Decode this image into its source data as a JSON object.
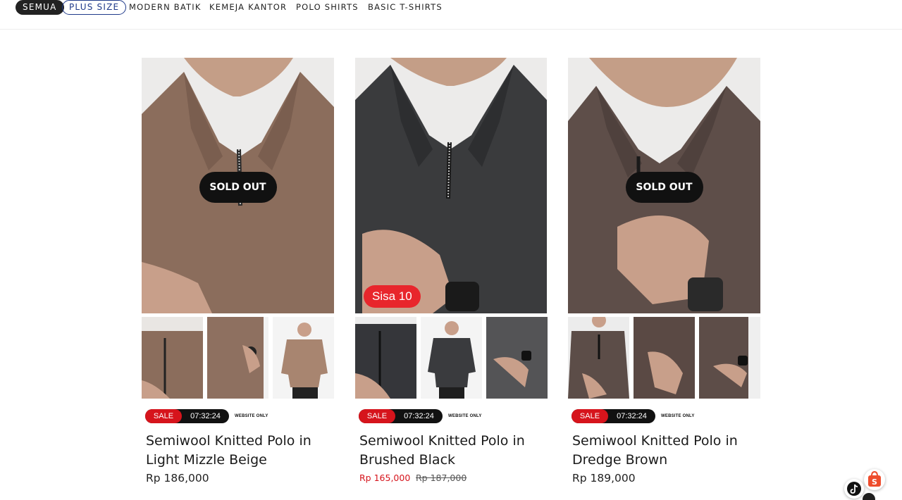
{
  "filters": {
    "items": [
      {
        "label": "SEMUA",
        "state": "active"
      },
      {
        "label": "PLUS SIZE",
        "state": "outline"
      },
      {
        "label": "MODERN BATIK",
        "state": "plain"
      },
      {
        "label": "KEMEJA KANTOR",
        "state": "plain"
      },
      {
        "label": "POLO SHIRTS",
        "state": "plain"
      },
      {
        "label": "BASIC T-SHIRTS",
        "state": "plain"
      }
    ]
  },
  "products": [
    {
      "name": "Semiwool Knitted Polo in Light Mizzle Beige",
      "badge": "SOLD OUT",
      "sale_label": "SALE",
      "timer": "07:32:24",
      "website_only": "WEBSITE ONLY",
      "price": "Rp 186,000",
      "shirt_color": "#8b6d5c"
    },
    {
      "name": "Semiwool Knitted Polo in Brushed Black",
      "stock_badge": "Sisa 10",
      "sale_label": "SALE",
      "timer": "07:32:24",
      "website_only": "WEBSITE ONLY",
      "sale_price": "Rp 165,000",
      "original_price": "Rp 187,000",
      "shirt_color": "#3a3b3d"
    },
    {
      "name": "Semiwool Knitted Polo in Dredge Brown",
      "badge": "SOLD OUT",
      "sale_label": "SALE",
      "timer": "07:32:24",
      "website_only": "WEBSITE ONLY",
      "price": "Rp 189,000",
      "shirt_color": "#5e4e49"
    }
  ],
  "floating": {
    "shop_icon": "shopee-bag-icon",
    "tiktok_icon": "tiktok-icon"
  },
  "colors": {
    "accent_red": "#d6141c",
    "chip_blue": "#1f3a8a",
    "dark": "#111111"
  }
}
